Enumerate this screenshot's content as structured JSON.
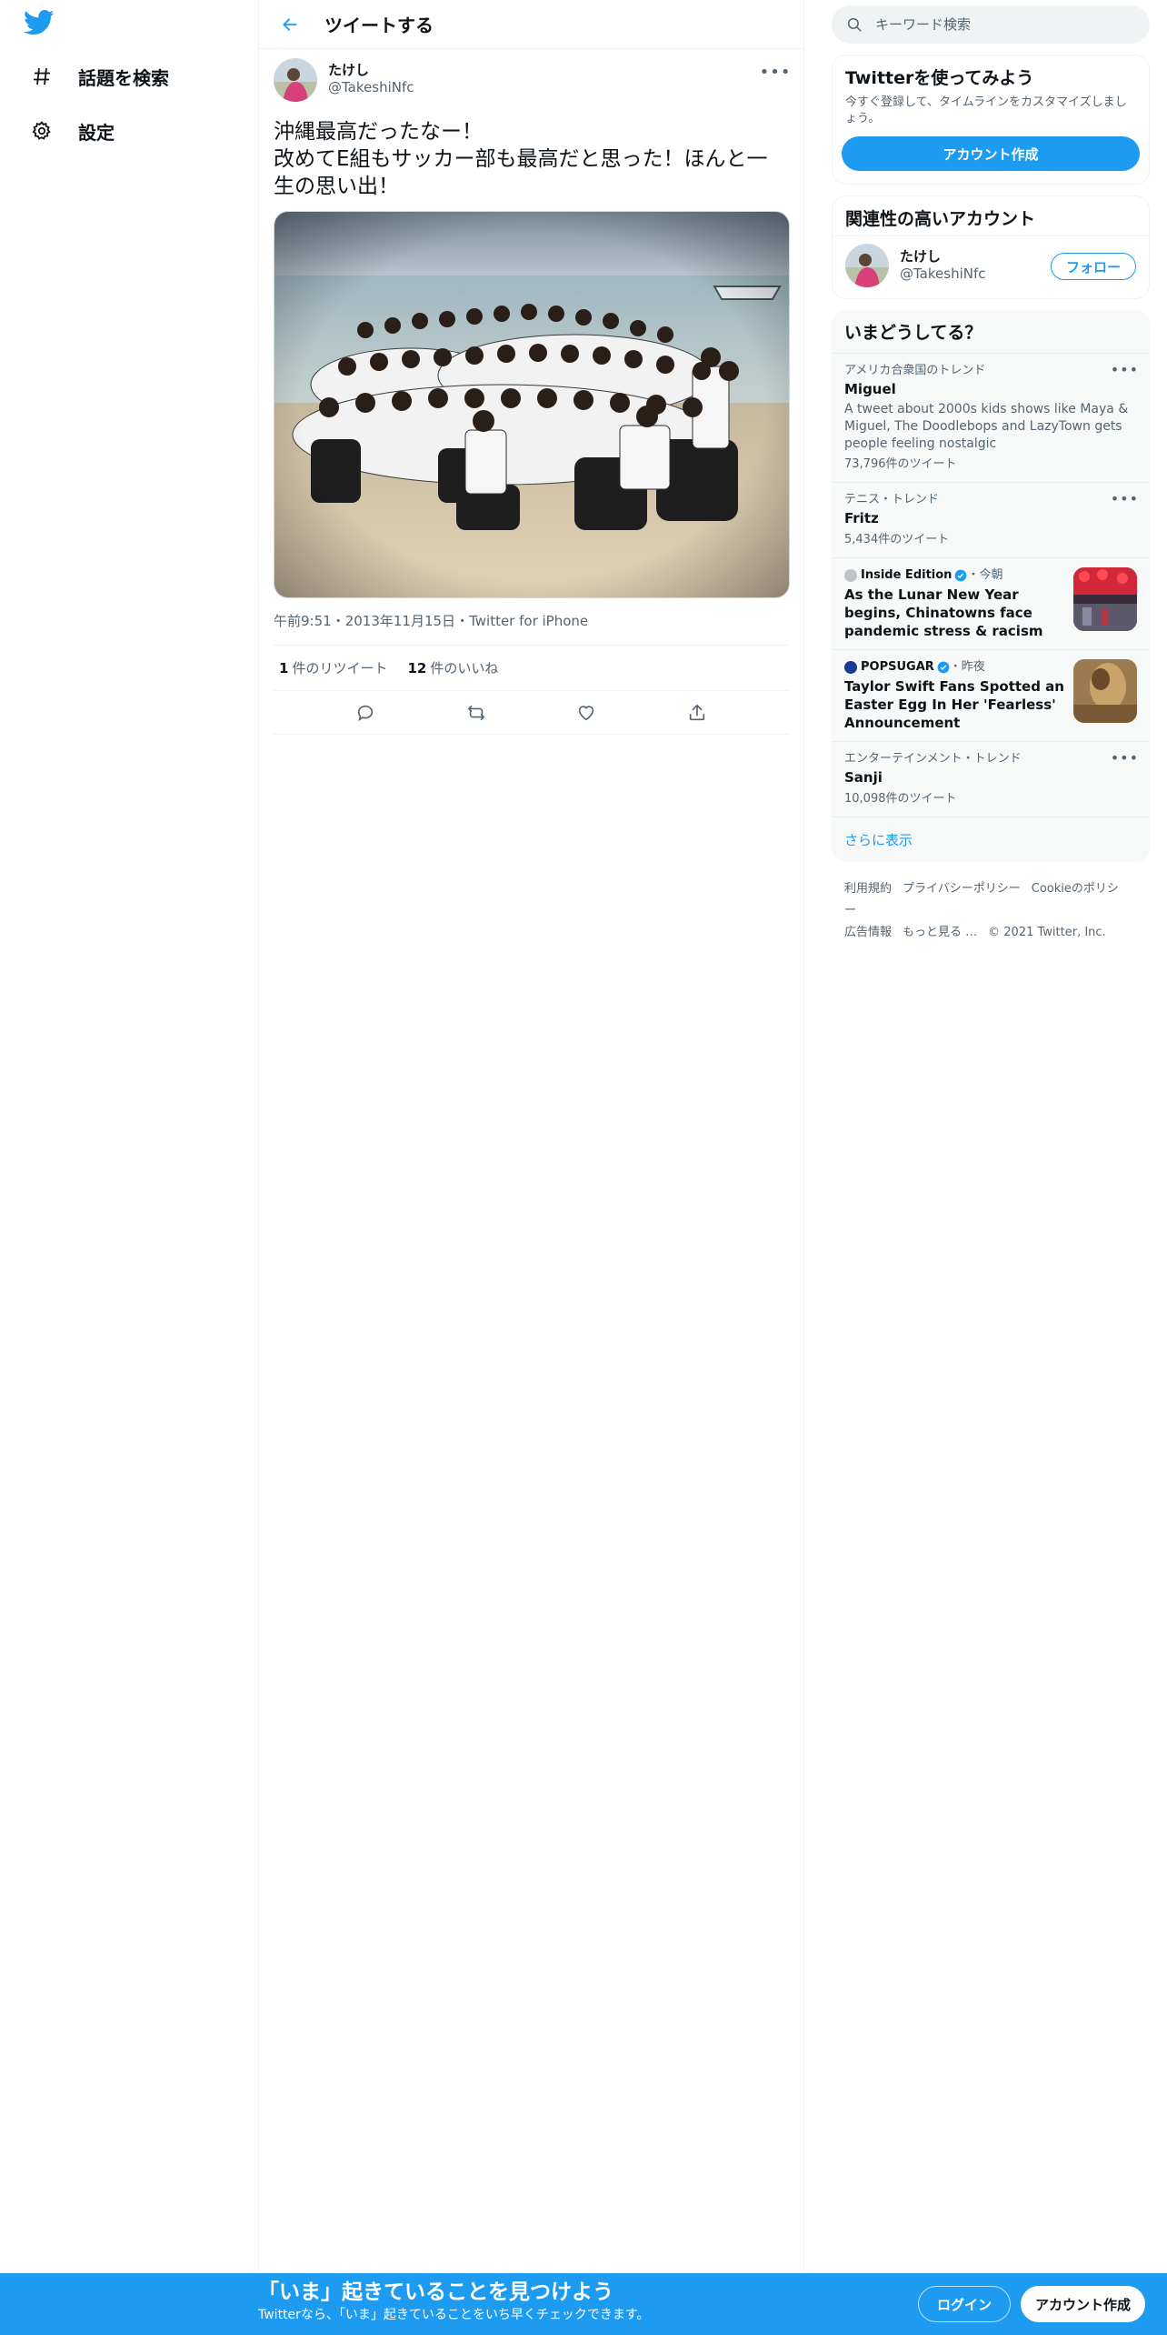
{
  "nav": {
    "logo": "twitter-bird-icon",
    "items": [
      {
        "icon": "hashtag-icon",
        "label": "話題を検索"
      },
      {
        "icon": "gear-icon",
        "label": "設定"
      }
    ]
  },
  "header": {
    "title": "ツイートする"
  },
  "tweet": {
    "author_name": "たけし",
    "author_handle": "@TakeshiNfc",
    "text_lines": [
      "沖縄最高だったなー！",
      "改めてE組もサッカー部も最高だと思った！ほんと一",
      "生の思い出！"
    ],
    "meta": {
      "time": "午前9:51",
      "sep1": "・",
      "date": "2013年11月15日",
      "sep2": "・",
      "source": "Twitter for iPhone"
    },
    "retweets": {
      "count": "1",
      "label": "件のリツイート"
    },
    "likes": {
      "count": "12",
      "label": "件のいいね"
    }
  },
  "search": {
    "placeholder": "キーワード検索"
  },
  "signup_card": {
    "title": "Twitterを使ってみよう",
    "desc": "今すぐ登録して、タイムラインをカスタマイズしましょう。",
    "button": "アカウント作成"
  },
  "related": {
    "title": "関連性の高いアカウント",
    "name": "たけし",
    "handle": "@TakeshiNfc",
    "follow": "フォロー"
  },
  "trends": {
    "title": "いまどうしてる？",
    "items": [
      {
        "context": "アメリカ合衆国のトレンド",
        "title": "Miguel",
        "desc": "A tweet about 2000s kids shows like Maya & Miguel, The Doodlebops and LazyTown gets people feeling nostalgic",
        "count": "73,796件のツイート"
      },
      {
        "context": "テニス・トレンド",
        "title": "Fritz",
        "count": "5,434件のツイート"
      }
    ],
    "news": [
      {
        "source": "Inside Edition",
        "time": "・今朝",
        "headline": "As the Lunar New Year begins, Chinatowns face pandemic stress & racism"
      },
      {
        "source": "POPSUGAR",
        "time": "・昨夜",
        "headline": "Taylor Swift Fans Spotted an Easter Egg In Her 'Fearless' Announcement"
      }
    ],
    "last": {
      "context": "エンターテインメント・トレンド",
      "title": "Sanji",
      "count": "10,098件のツイート"
    },
    "show_more": "さらに表示"
  },
  "footer": {
    "links": [
      "利用規約",
      "プライバシーポリシー",
      "Cookieのポリシー",
      "広告情報",
      "もっと見る …"
    ],
    "copyright": "© 2021 Twitter, Inc."
  },
  "banner": {
    "title": "「いま」起きていることを見つけよう",
    "subtitle": "Twitterなら、「いま」起きていることをいち早くチェックできます。",
    "login": "ログイン",
    "signup": "アカウント作成"
  },
  "colors": {
    "accent": "#1d9bf0",
    "text_primary": "#0f1419",
    "text_secondary": "#536471",
    "border": "#eff3f4"
  }
}
